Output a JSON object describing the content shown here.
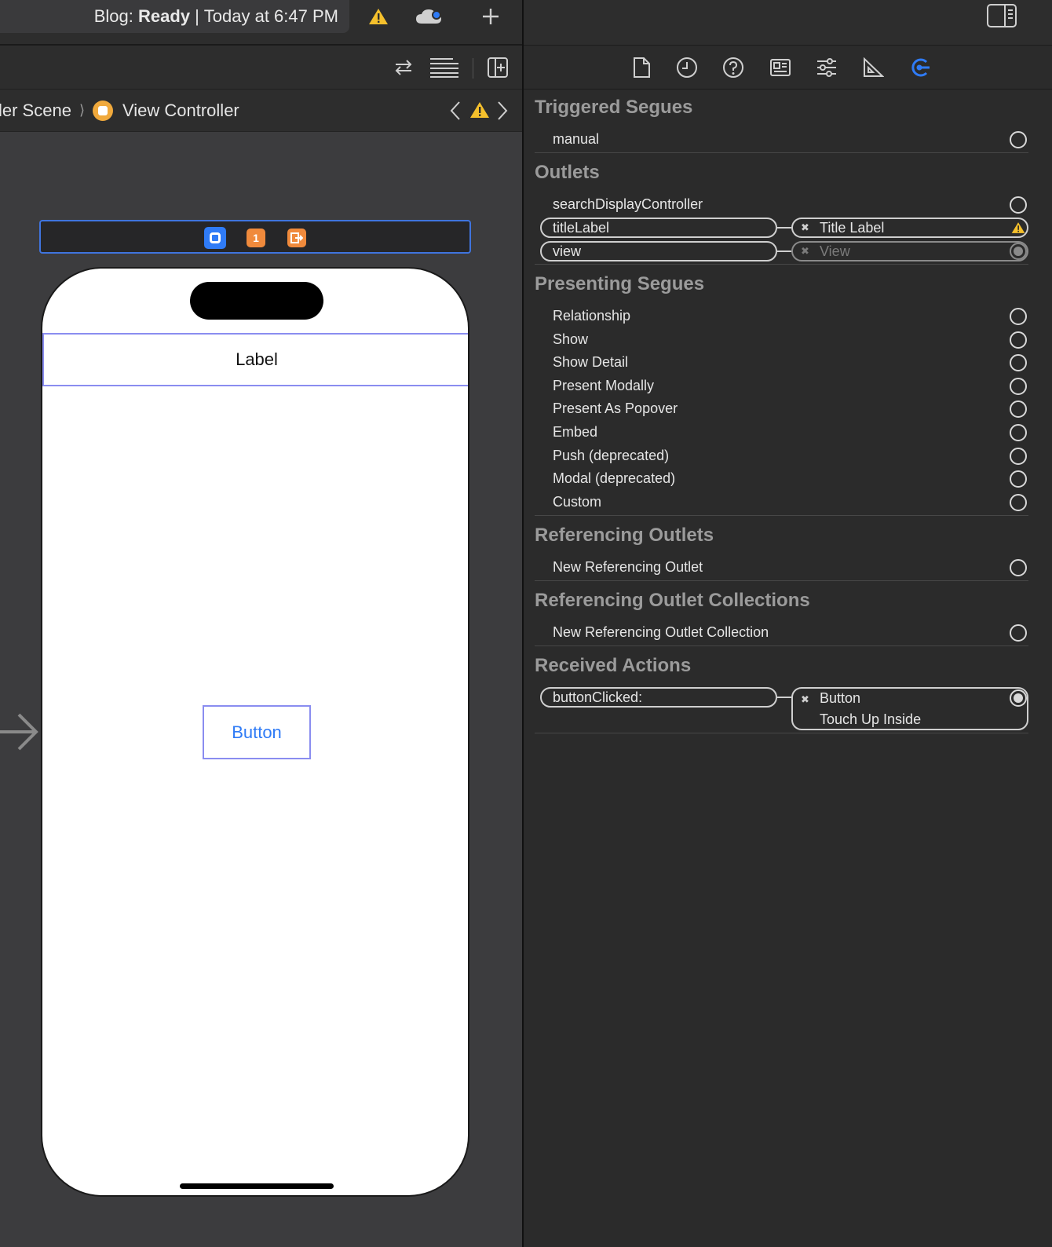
{
  "status": {
    "project": "Blog:",
    "state": "Ready",
    "separator": "|",
    "time": "Today at 6:47 PM"
  },
  "breadcrumb": {
    "scene": "ler Scene",
    "controller": "View Controller"
  },
  "canvas": {
    "label_text": "Label",
    "button_text": "Button"
  },
  "inspector": {
    "triggered_segues": {
      "title": "Triggered Segues",
      "items": [
        "manual"
      ]
    },
    "outlets": {
      "title": "Outlets",
      "items": [
        {
          "name": "searchDisplayController"
        },
        {
          "name": "titleLabel",
          "target": "Title Label"
        },
        {
          "name": "view",
          "target": "View"
        }
      ]
    },
    "presenting_segues": {
      "title": "Presenting Segues",
      "items": [
        "Relationship",
        "Show",
        "Show Detail",
        "Present Modally",
        "Present As Popover",
        "Embed",
        "Push (deprecated)",
        "Modal (deprecated)",
        "Custom"
      ]
    },
    "referencing_outlets": {
      "title": "Referencing Outlets",
      "items": [
        "New Referencing Outlet"
      ]
    },
    "referencing_outlet_collections": {
      "title": "Referencing Outlet Collections",
      "items": [
        "New Referencing Outlet Collection"
      ]
    },
    "received_actions": {
      "title": "Received Actions",
      "action": "buttonClicked:",
      "target": "Button",
      "event": "Touch Up Inside"
    }
  },
  "colors": {
    "accent": "#2f7bf6",
    "warning": "#f5c02c",
    "scene_icon": "#f0a93c"
  }
}
